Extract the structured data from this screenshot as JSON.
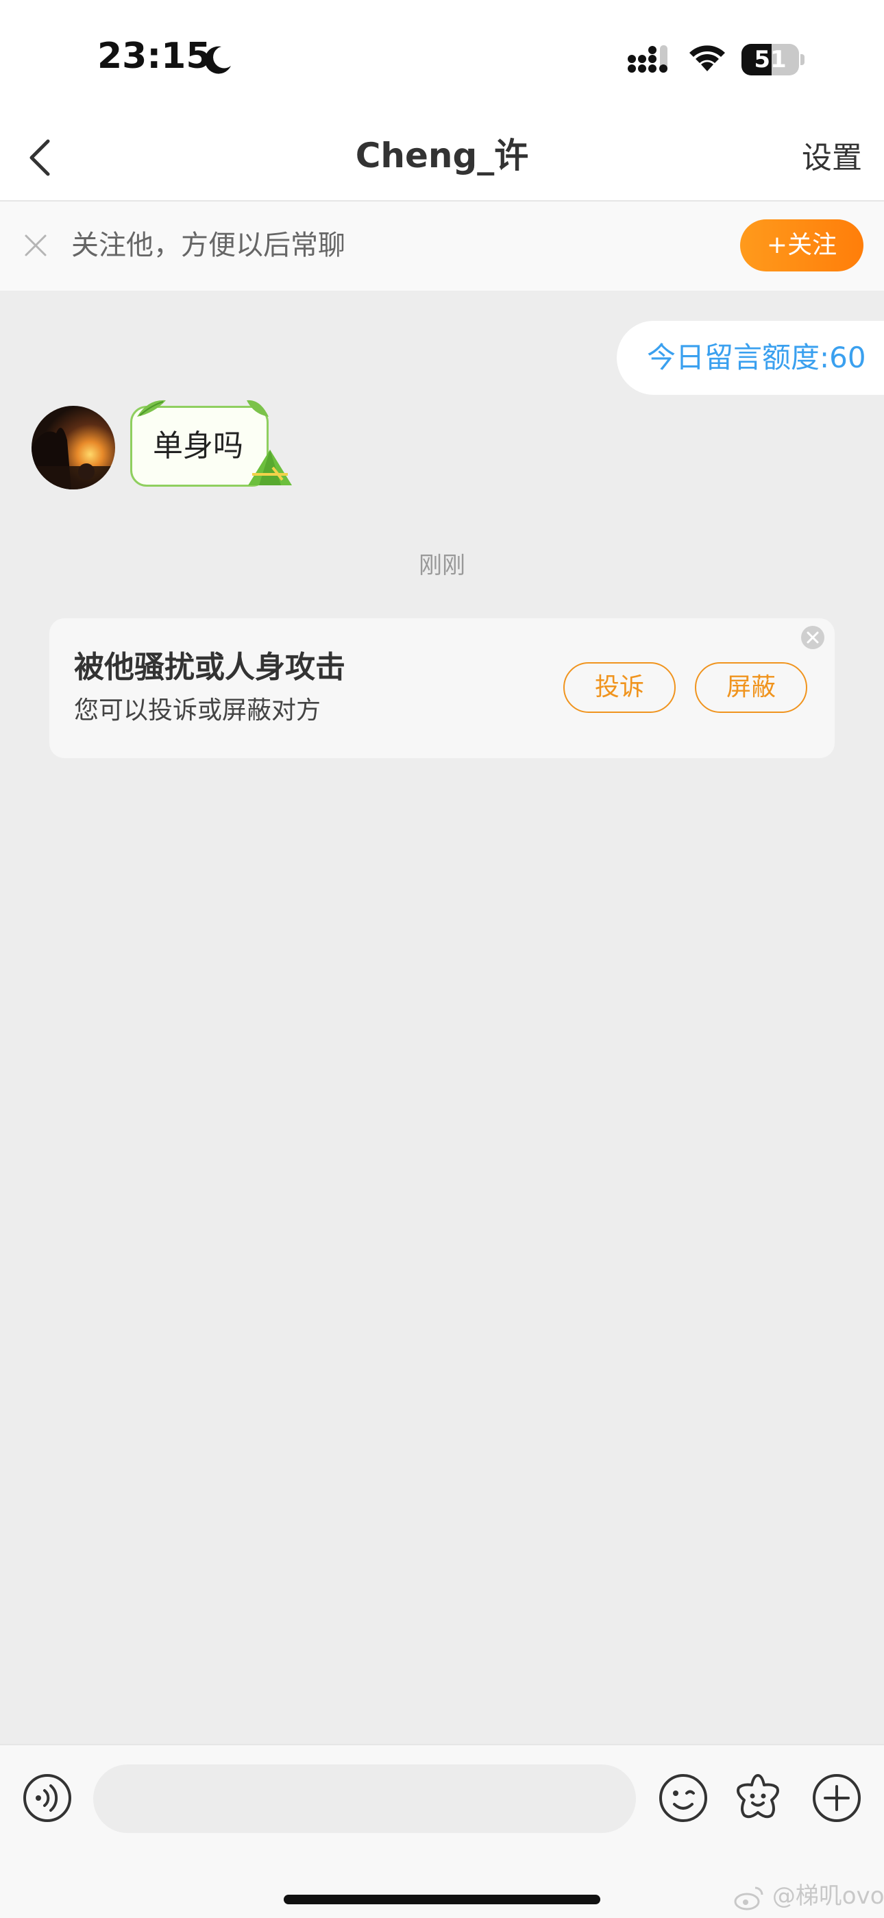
{
  "status_bar": {
    "time": "23:15",
    "battery": "51"
  },
  "nav": {
    "title": "Cheng_许",
    "settings_label": "设置"
  },
  "follow_banner": {
    "text": "关注他，方便以后常聊",
    "follow_label": "+关注"
  },
  "chat": {
    "quota": "今日留言额度:60",
    "messages": [
      {
        "text": "单身吗"
      }
    ],
    "timestamp": "刚刚"
  },
  "report_card": {
    "title": "被他骚扰或人身攻击",
    "subtitle": "您可以投诉或屏蔽对方",
    "report_label": "投诉",
    "block_label": "屏蔽"
  },
  "input": {
    "placeholder": ""
  },
  "watermark": "@梯叽ovo",
  "colors": {
    "accent_orange": "#ff8a14",
    "quota_blue": "#3aa0ef",
    "bubble_green": "#8fcf5f",
    "background": "#ededed"
  },
  "icons": {
    "moon": "moon-icon",
    "signal": "signal-icon",
    "wifi": "wifi-icon",
    "back": "chevron-left-icon",
    "close": "close-icon",
    "voice": "voice-icon",
    "emoji": "emoji-icon",
    "sticker": "sticker-icon",
    "plus": "plus-icon"
  }
}
